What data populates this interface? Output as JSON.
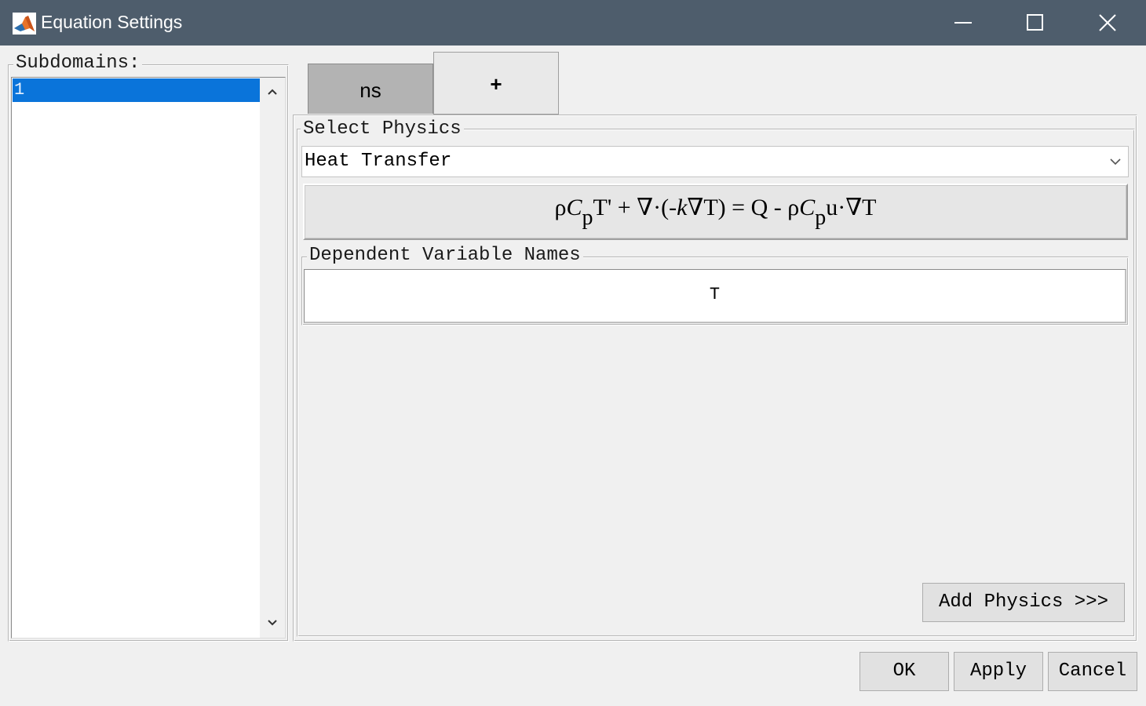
{
  "window": {
    "title": "Equation Settings",
    "icons": {
      "app": "matlab-logo-icon",
      "minimize": "minimize-icon",
      "maximize": "maximize-icon",
      "close": "close-icon"
    },
    "colors": {
      "titlebar": "#4e5d6c",
      "selection": "#0a74da"
    }
  },
  "subdomains": {
    "label": "Subdomains:",
    "items": [
      "1"
    ],
    "selected": "1"
  },
  "tabs": [
    {
      "label": "ns",
      "active": true
    },
    {
      "label": "+",
      "active": false
    }
  ],
  "physics": {
    "group_label": "Select Physics",
    "selected": "Heat Transfer",
    "equation": {
      "p1": "ρ",
      "p2": "C",
      "p3": "p",
      "p4": "T' + ∇·(-",
      "p5": "k",
      "p6": "∇T) = Q - ρ",
      "p7": "C",
      "p8": "p",
      "p9": "u·∇T"
    },
    "dependent_variables": {
      "label": "Dependent Variable Names",
      "value": "T"
    },
    "add_button": "Add Physics >>>"
  },
  "buttons": {
    "ok": "OK",
    "apply": "Apply",
    "cancel": "Cancel"
  }
}
